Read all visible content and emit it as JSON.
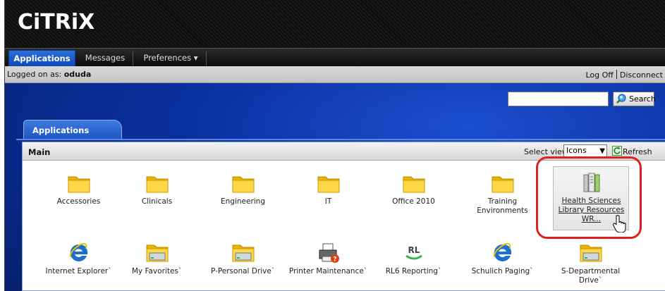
{
  "brand": {
    "logo": "CiTRiX"
  },
  "nav": {
    "tabs": [
      {
        "label": "Applications",
        "active": true
      },
      {
        "label": "Messages",
        "active": false
      },
      {
        "label": "Preferences ▾",
        "active": false
      }
    ]
  },
  "status": {
    "logged_prefix": "Logged on as: ",
    "user": "oduda",
    "logoff": "Log Off",
    "disconnect": "Disconnect"
  },
  "search": {
    "value": "",
    "button_label": "Search"
  },
  "apps_tab": {
    "label": "Applications"
  },
  "panel": {
    "title": "Main",
    "select_view_label": "Select view:",
    "view_value": "Icons",
    "refresh_label": "Refresh"
  },
  "apps": [
    {
      "name": "Accessories",
      "icon": "folder-icon"
    },
    {
      "name": "Clinicals",
      "icon": "folder-icon"
    },
    {
      "name": "Engineering",
      "icon": "folder-icon"
    },
    {
      "name": "IT",
      "icon": "folder-icon"
    },
    {
      "name": "Office 2010",
      "icon": "folder-icon"
    },
    {
      "name": "Training Environments",
      "icon": "folder-icon"
    },
    {
      "name": "Health Sciences Library Resources WR...",
      "icon": "books-icon"
    },
    {
      "name": "Internet Explorer`",
      "icon": "internet-explorer-icon"
    },
    {
      "name": "My Favorites`",
      "icon": "drive-icon"
    },
    {
      "name": "P-Personal Drive`",
      "icon": "drive-icon"
    },
    {
      "name": "Printer Maintenance`",
      "icon": "printer-icon"
    },
    {
      "name": "RL6 Reporting`",
      "icon": "rl6-icon"
    },
    {
      "name": "Schulich Paging`",
      "icon": "internet-explorer-icon"
    },
    {
      "name": "S-Departmental Drive`",
      "icon": "drive-icon"
    }
  ],
  "colors": {
    "nav_active": "#1d55c2",
    "highlight": "#e02020",
    "folder": "#f2c400"
  }
}
